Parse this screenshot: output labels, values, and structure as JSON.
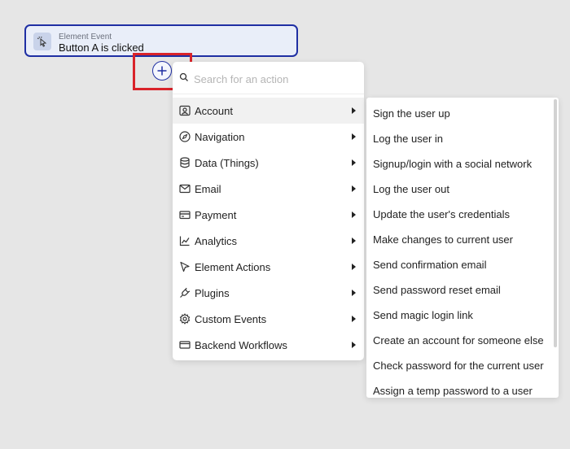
{
  "event": {
    "kicker": "Element Event",
    "title": "Button A is clicked",
    "icon": "cursor-click-icon"
  },
  "add_button": {
    "icon": "plus-circle-icon"
  },
  "search": {
    "placeholder": "Search for an action",
    "value": "",
    "icon": "search-icon"
  },
  "categories": [
    {
      "label": "Account",
      "icon": "user-card-icon",
      "active": true
    },
    {
      "label": "Navigation",
      "icon": "compass-icon",
      "active": false
    },
    {
      "label": "Data (Things)",
      "icon": "database-icon",
      "active": false
    },
    {
      "label": "Email",
      "icon": "envelope-icon",
      "active": false
    },
    {
      "label": "Payment",
      "icon": "credit-card-icon",
      "active": false
    },
    {
      "label": "Analytics",
      "icon": "chart-line-icon",
      "active": false
    },
    {
      "label": "Element Actions",
      "icon": "pointer-icon",
      "active": false
    },
    {
      "label": "Plugins",
      "icon": "plug-icon",
      "active": false
    },
    {
      "label": "Custom Events",
      "icon": "gear-icon",
      "active": false
    },
    {
      "label": "Backend Workflows",
      "icon": "window-icon",
      "active": false
    }
  ],
  "account_actions": [
    "Sign the user up",
    "Log the user in",
    "Signup/login with a social network",
    "Log the user out",
    "Update the user's credentials",
    "Make changes to current user",
    "Send confirmation email",
    "Send password reset email",
    "Send magic login link",
    "Create an account for someone else",
    "Check password for the current user",
    "Assign a temp password to a user"
  ],
  "colors": {
    "accent": "#1f2fa3",
    "highlight": "#d9232a",
    "event_bg": "#e9eef9"
  }
}
